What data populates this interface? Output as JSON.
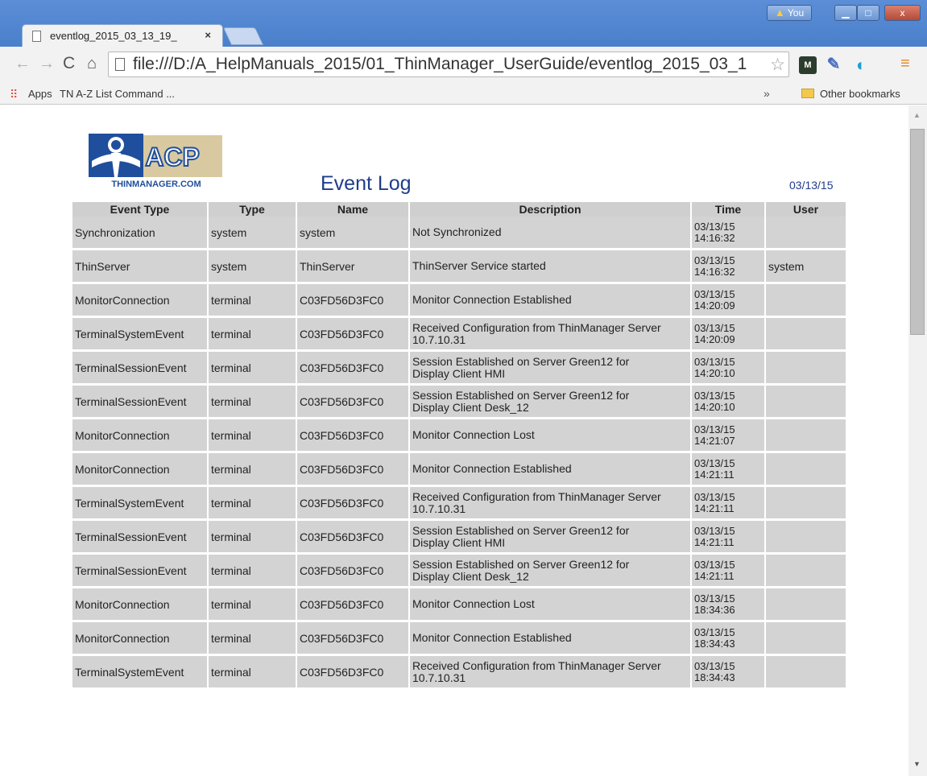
{
  "browser": {
    "tab_title": "eventlog_2015_03_13_19_",
    "tab_close": "×",
    "user_label": "You",
    "window_controls": {
      "minimize": "▁",
      "maximize": "□",
      "close": "x"
    },
    "url": "file:///D:/A_HelpManuals_2015/01_ThinManager_UserGuide/eventlog_2015_03_1",
    "extensions": {
      "m_label": "M"
    },
    "bookmarks": [
      {
        "label": "Apps"
      },
      {
        "label": "TN A-Z List Command ..."
      }
    ],
    "bookmarks_overflow": "»",
    "other_bookmarks": "Other bookmarks"
  },
  "page": {
    "logo": {
      "brand": "ACP",
      "caption": "THINMANAGER.COM"
    },
    "title": "Event Log",
    "date": "03/13/15",
    "columns": [
      "Event Type",
      "Type",
      "Name",
      "Description",
      "Time",
      "User"
    ],
    "rows": [
      {
        "event_type": "Synchronization",
        "type": "system",
        "name": "system",
        "description": "Not Synchronized",
        "date": "03/13/15",
        "time": "14:16:32",
        "user": ""
      },
      {
        "event_type": "ThinServer",
        "type": "system",
        "name": "ThinServer",
        "description": "ThinServer Service started",
        "date": "03/13/15",
        "time": "14:16:32",
        "user": "system"
      },
      {
        "event_type": "MonitorConnection",
        "type": "terminal",
        "name": "C03FD56D3FC0",
        "description": "Monitor Connection Established",
        "date": "03/13/15",
        "time": "14:20:09",
        "user": ""
      },
      {
        "event_type": "TerminalSystemEvent",
        "type": "terminal",
        "name": "C03FD56D3FC0",
        "description": "Received Configuration from ThinManager Server 10.7.10.31",
        "date": "03/13/15",
        "time": "14:20:09",
        "user": ""
      },
      {
        "event_type": "TerminalSessionEvent",
        "type": "terminal",
        "name": "C03FD56D3FC0",
        "description": "Session Established on Server Green12 for Display Client HMI",
        "date": "03/13/15",
        "time": "14:20:10",
        "user": ""
      },
      {
        "event_type": "TerminalSessionEvent",
        "type": "terminal",
        "name": "C03FD56D3FC0",
        "description": "Session Established on Server Green12 for Display Client Desk_12",
        "date": "03/13/15",
        "time": "14:20:10",
        "user": ""
      },
      {
        "event_type": "MonitorConnection",
        "type": "terminal",
        "name": "C03FD56D3FC0",
        "description": "Monitor Connection Lost",
        "date": "03/13/15",
        "time": "14:21:07",
        "user": ""
      },
      {
        "event_type": "MonitorConnection",
        "type": "terminal",
        "name": "C03FD56D3FC0",
        "description": "Monitor Connection Established",
        "date": "03/13/15",
        "time": "14:21:11",
        "user": ""
      },
      {
        "event_type": "TerminalSystemEvent",
        "type": "terminal",
        "name": "C03FD56D3FC0",
        "description": "Received Configuration from ThinManager Server 10.7.10.31",
        "date": "03/13/15",
        "time": "14:21:11",
        "user": ""
      },
      {
        "event_type": "TerminalSessionEvent",
        "type": "terminal",
        "name": "C03FD56D3FC0",
        "description": "Session Established on Server Green12 for Display Client HMI",
        "date": "03/13/15",
        "time": "14:21:11",
        "user": ""
      },
      {
        "event_type": "TerminalSessionEvent",
        "type": "terminal",
        "name": "C03FD56D3FC0",
        "description": "Session Established on Server Green12 for Display Client Desk_12",
        "date": "03/13/15",
        "time": "14:21:11",
        "user": ""
      },
      {
        "event_type": "MonitorConnection",
        "type": "terminal",
        "name": "C03FD56D3FC0",
        "description": "Monitor Connection Lost",
        "date": "03/13/15",
        "time": "18:34:36",
        "user": ""
      },
      {
        "event_type": "MonitorConnection",
        "type": "terminal",
        "name": "C03FD56D3FC0",
        "description": "Monitor Connection Established",
        "date": "03/13/15",
        "time": "18:34:43",
        "user": ""
      },
      {
        "event_type": "TerminalSystemEvent",
        "type": "terminal",
        "name": "C03FD56D3FC0",
        "description": "Received Configuration from ThinManager Server 10.7.10.31",
        "date": "03/13/15",
        "time": "18:34:43",
        "user": ""
      }
    ]
  },
  "colors": {
    "title_blue": "#1f3c8c",
    "table_cell": "#d3d3d3",
    "chrome_frame": "#4a7fcb",
    "logo_gold": "#d8c9a0",
    "logo_blue": "#1f4e9c"
  }
}
